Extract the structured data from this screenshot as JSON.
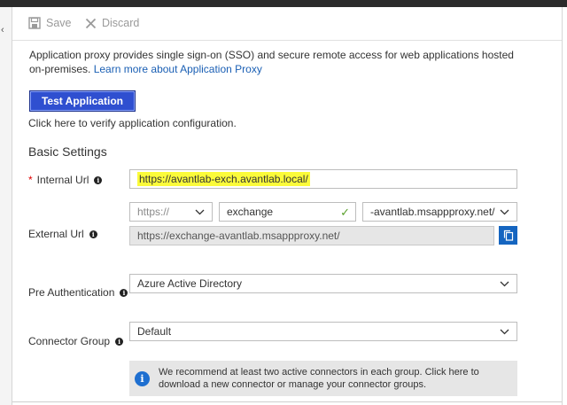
{
  "toolbar": {
    "save_label": "Save",
    "discard_label": "Discard"
  },
  "intro": {
    "text": "Application proxy provides single sign-on (SSO) and secure remote access for web applications hosted on-premises. ",
    "link_text": "Learn more about Application Proxy"
  },
  "test_button": {
    "label": "Test Application",
    "hint": "Click here to verify application configuration."
  },
  "basic_settings": {
    "title": "Basic Settings",
    "internal_url": {
      "label": "Internal Url",
      "value": "https://avantlab-exch.avantlab.local/"
    },
    "external_url": {
      "label": "External Url",
      "scheme": "https://",
      "subdomain": "exchange",
      "domain": "-avantlab.msappproxy.net/",
      "full": "https://exchange-avantlab.msappproxy.net/"
    },
    "pre_authentication": {
      "label": "Pre Authentication",
      "value": "Azure Active Directory"
    },
    "connector_group": {
      "label": "Connector Group",
      "value": "Default"
    },
    "info_message": "We recommend at least two active connectors in each group. Click here to download a new connector or manage your connector groups."
  },
  "colors": {
    "accent": "#2f4fd0",
    "highlight": "#fbfb3a",
    "link": "#1a5fb4",
    "valid": "#5aa02c"
  }
}
